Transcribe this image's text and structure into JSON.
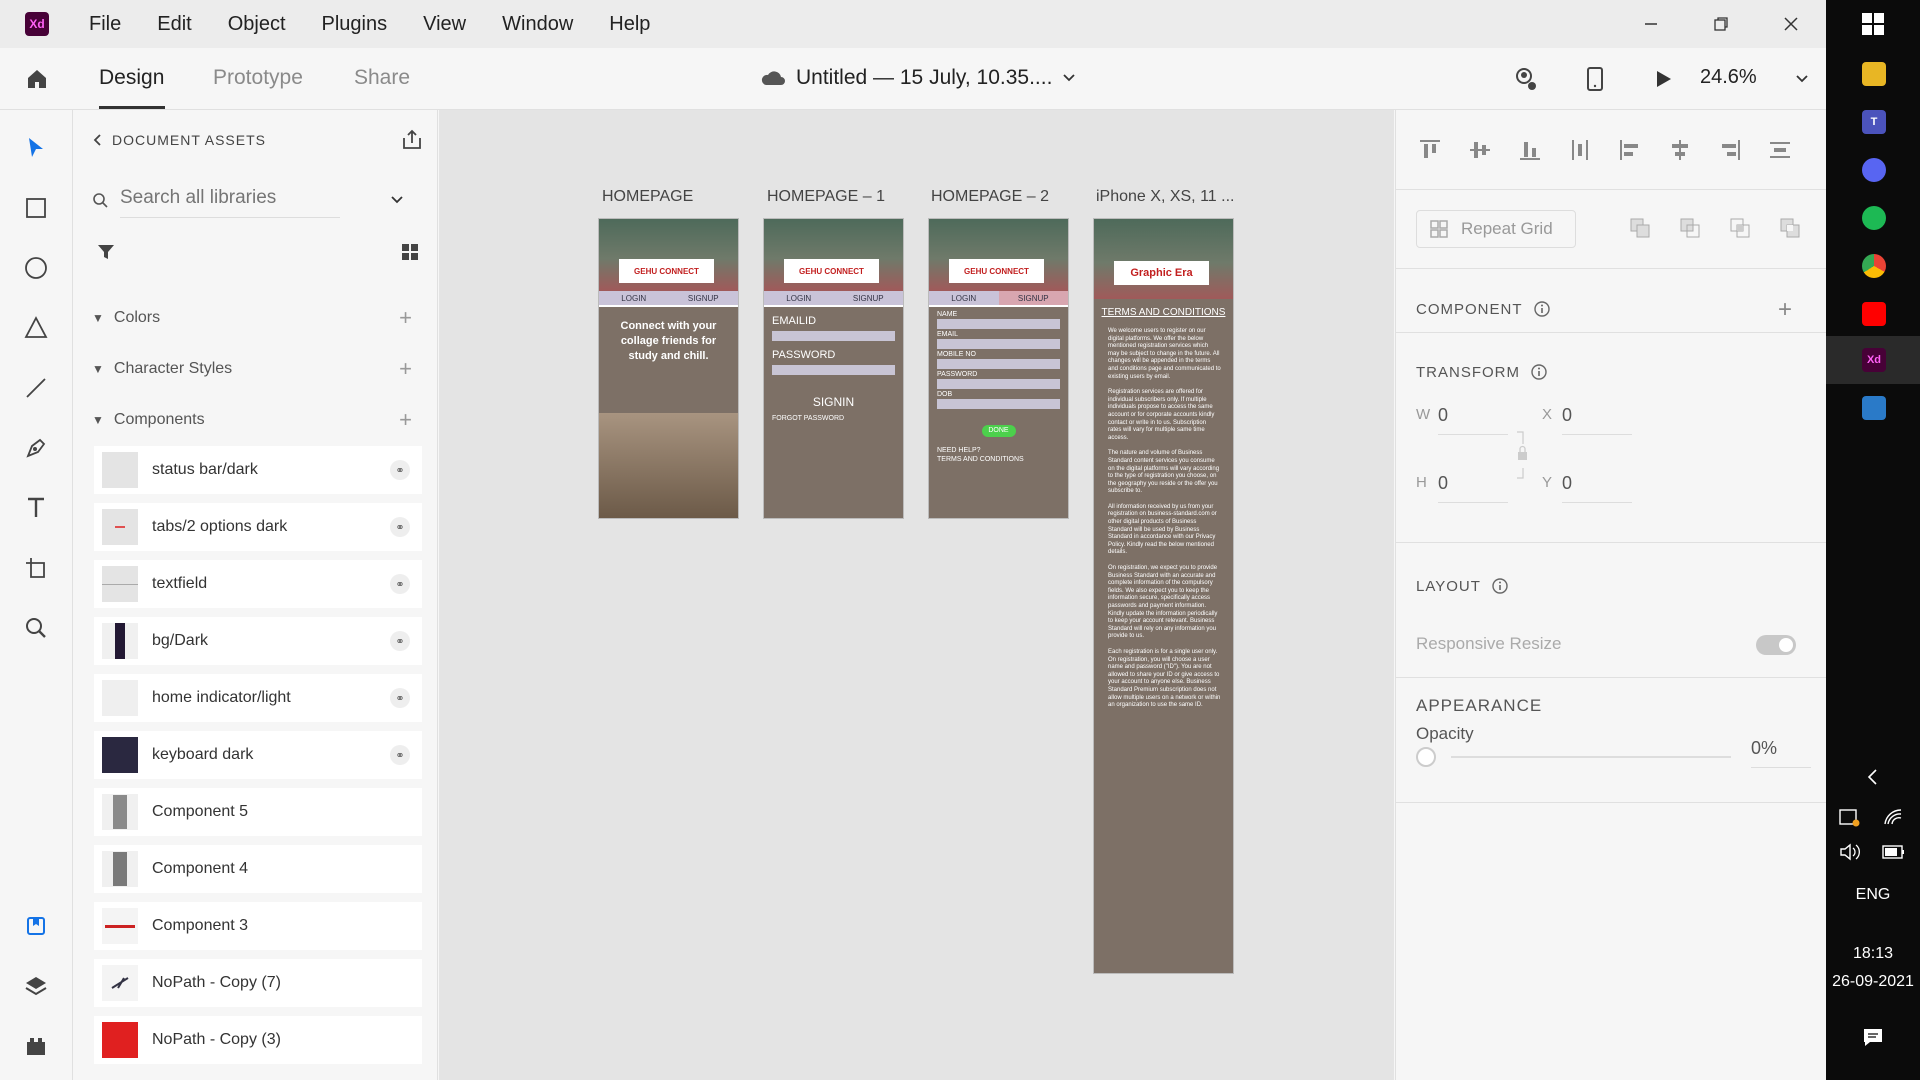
{
  "app": {
    "logo_text": "Xd",
    "menu": [
      "File",
      "Edit",
      "Object",
      "Plugins",
      "View",
      "Window",
      "Help"
    ],
    "mode_tabs": [
      "Design",
      "Prototype",
      "Share"
    ],
    "document_title": "Untitled — 15 July, 10.35....",
    "zoom": "24.6%"
  },
  "assets": {
    "header": "DOCUMENT ASSETS",
    "search_placeholder": "Search all libraries",
    "sections": [
      "Colors",
      "Character Styles",
      "Components"
    ],
    "components": [
      "status bar/dark",
      "tabs/2 options dark",
      "textfield",
      "bg/Dark",
      "home indicator/light",
      "keyboard dark",
      "Component 5",
      "Component 4",
      "Component 3",
      "NoPath - Copy (7)",
      "NoPath - Copy (3)"
    ]
  },
  "canvas": {
    "artboards": [
      "HOMEPAGE",
      "HOMEPAGE – 1",
      "HOMEPAGE – 2",
      "iPhone X, XS, 11 ..."
    ],
    "home": {
      "logo": "GEHU CONNECT",
      "tab_login": "LOGIN",
      "tab_signup": "SIGNUP",
      "tagline": "Connect with your collage friends for study and chill."
    },
    "login": {
      "email_label": "EMAILID",
      "password_label": "PASSWORD",
      "signin": "SIGNIN",
      "forgot": "FORGOT PASSWORD"
    },
    "signup": {
      "fields": [
        "NAME",
        "EMAIL",
        "MOBILE NO",
        "PASSWORD",
        "DOB"
      ],
      "done": "DONE",
      "need_help": "NEED HELP?",
      "terms_link": "TERMS AND CONDITIONS"
    },
    "terms": {
      "logo": "Graphic Era",
      "title": "TERMS AND CONDITIONS",
      "paragraphs": [
        "We welcome users to register on our digital platforms. We offer the below mentioned registration services which may be subject to change in the future. All changes will be appended in the terms and conditions page and communicated to existing users by email.",
        "Registration services are offered for individual subscribers only. If multiple individuals propose to access the same account or for corporate accounts kindly contact or write in to us. Subscription rates will vary for multiple same time access.",
        "The nature and volume of Business Standard content services you consume on the digital platforms will vary according to the type of registration you choose, on the geography you reside or the offer you subscribe to.",
        "All information received by us from your registration on business-standard.com or other digital products of Business Standard will be used by Business Standard in accordance with our Privacy Policy. Kindly read the below mentioned details.",
        "On registration, we expect you to provide Business Standard with an accurate and complete information of the compulsory fields. We also expect you to keep the information secure, specifically access passwords and payment information. Kindly update the information periodically to keep your account relevant. Business Standard will rely on any information you provide to us.",
        "Each registration is for a single user only. On registration, you will choose a user name and password (\"ID\"). You are not allowed to share your ID or give access to your account to anyone else. Business Standard Premium subscription does not allow multiple users on a network or within an organization to use the same ID."
      ]
    }
  },
  "inspector": {
    "repeat_grid": "Repeat Grid",
    "component_header": "COMPONENT",
    "transform_header": "TRANSFORM",
    "w_label": "W",
    "w_value": "0",
    "h_label": "H",
    "h_value": "0",
    "x_label": "X",
    "x_value": "0",
    "y_label": "Y",
    "y_value": "0",
    "layout_header": "LAYOUT",
    "responsive_resize": "Responsive Resize",
    "appearance_header": "APPEARANCE",
    "opacity_label": "Opacity",
    "opacity_value": "0%"
  },
  "taskbar": {
    "language": "ENG",
    "time": "18:13",
    "date": "26-09-2021"
  }
}
